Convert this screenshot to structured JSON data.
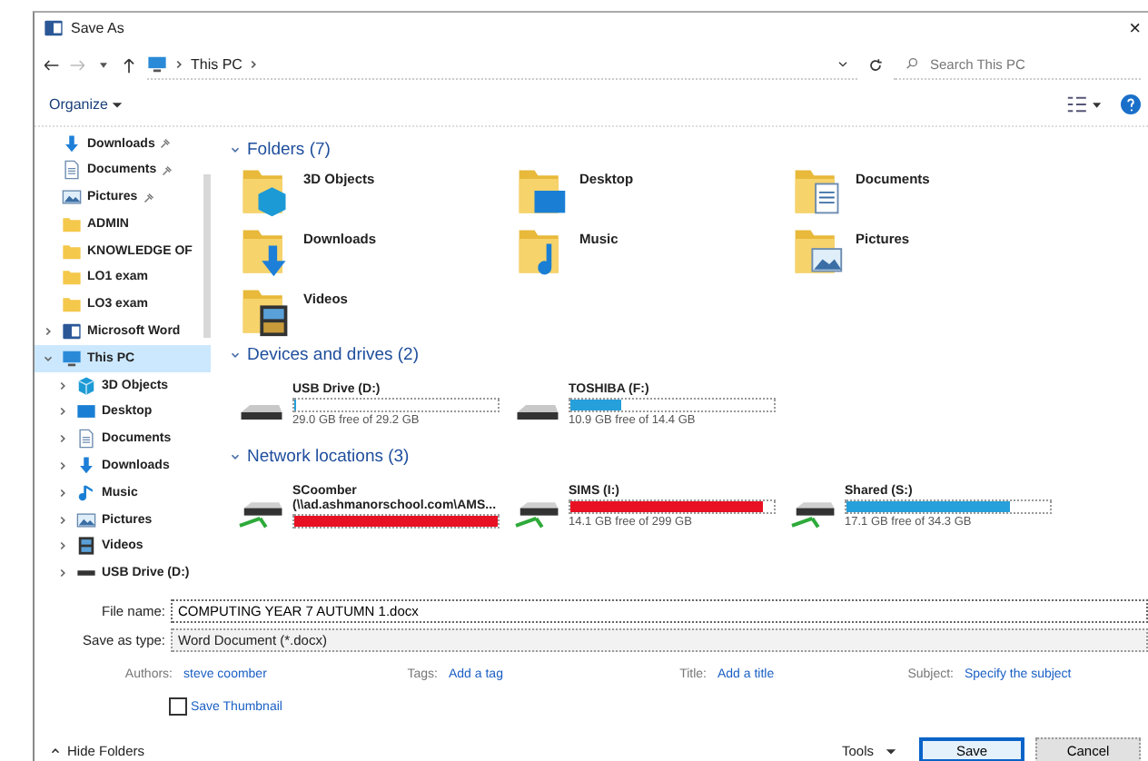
{
  "window": {
    "title": "Save As",
    "close": "×"
  },
  "address_bar": {
    "path": [
      "This PC"
    ]
  },
  "search": {
    "placeholder": "Search This PC"
  },
  "toolbar": {
    "organize": "Organize"
  },
  "sidebar": {
    "items": [
      {
        "label": "Downloads",
        "kind": "download",
        "pinned": true,
        "selected": false
      },
      {
        "label": "Documents",
        "kind": "document",
        "pinned": true,
        "selected": false
      },
      {
        "label": "Pictures",
        "kind": "picture",
        "pinned": true,
        "selected": false
      },
      {
        "label": "ADMIN",
        "kind": "folder",
        "pinned": false,
        "selected": false
      },
      {
        "label": "KNOWLEDGE OF",
        "kind": "folder",
        "pinned": false,
        "selected": false
      },
      {
        "label": "LO1 exam",
        "kind": "folder",
        "pinned": false,
        "selected": false
      },
      {
        "label": "LO3 exam",
        "kind": "folder",
        "pinned": false,
        "selected": false
      },
      {
        "label": "Microsoft Word",
        "kind": "word",
        "expanded": false,
        "selected": false
      },
      {
        "label": "This PC",
        "kind": "pc",
        "expanded": true,
        "selected": true,
        "children": [
          {
            "label": "3D Objects",
            "kind": "cube",
            "expanded": false,
            "selected": false
          },
          {
            "label": "Desktop",
            "kind": "desktop",
            "expanded": false,
            "selected": false
          },
          {
            "label": "Documents",
            "kind": "document",
            "expanded": false,
            "selected": false
          },
          {
            "label": "Downloads",
            "kind": "download",
            "expanded": false,
            "selected": false
          },
          {
            "label": "Music",
            "kind": "music",
            "expanded": false,
            "selected": false
          },
          {
            "label": "Pictures",
            "kind": "picture",
            "expanded": false,
            "selected": false
          },
          {
            "label": "Videos",
            "kind": "video",
            "expanded": false,
            "selected": false
          },
          {
            "label": "USB Drive (D:)",
            "kind": "drive",
            "expanded": false,
            "selected": false
          }
        ]
      }
    ]
  },
  "content": {
    "sections": [
      {
        "title": "Folders (7)",
        "kind": "folders",
        "expanded": true,
        "items": [
          {
            "name": "3D Objects",
            "kind": "cube"
          },
          {
            "name": "Desktop",
            "kind": "desktop"
          },
          {
            "name": "Documents",
            "kind": "document"
          },
          {
            "name": "Downloads",
            "kind": "download"
          },
          {
            "name": "Music",
            "kind": "music"
          },
          {
            "name": "Pictures",
            "kind": "picture"
          },
          {
            "name": "Videos",
            "kind": "video"
          }
        ]
      },
      {
        "title": "Devices and drives (2)",
        "kind": "drives",
        "expanded": true,
        "items": [
          {
            "name": "USB Drive (D:)",
            "kind": "usb",
            "level": 0.01,
            "color": "#26a0da",
            "free": "29.0 GB free of 29.2 GB"
          },
          {
            "name": "TOSHIBA (F:)",
            "kind": "usb",
            "level": 0.25,
            "color": "#26a0da",
            "free": "10.9 GB free of 14.4 GB"
          }
        ]
      },
      {
        "title": "Network locations (3)",
        "kind": "drives",
        "expanded": true,
        "items": [
          {
            "name": "SCoomber",
            "path": "(\\\\ad.ashmanorschool.com\\AMS...",
            "kind": "network",
            "level": 1,
            "color": "#e81123"
          },
          {
            "name": "SIMS (I:)",
            "kind": "network",
            "level": 0.95,
            "color": "#e81123",
            "free": "14.1 GB free of 299 GB"
          },
          {
            "name": "Shared (S:)",
            "kind": "network",
            "level": 0.8,
            "color": "#26a0da",
            "free": "17.1 GB free of 34.3 GB"
          }
        ]
      }
    ]
  },
  "form": {
    "file_name": {
      "label": "File name:",
      "value": "COMPUTING YEAR 7 AUTUMN 1.docx"
    },
    "save_as_type": {
      "label": "Save as type:",
      "value": "Word Document (*.docx)"
    },
    "properties": [
      {
        "label": "Authors:",
        "value": "steve coomber"
      },
      {
        "label": "Tags:",
        "value": "Add a tag"
      },
      {
        "label": "Title:",
        "value": "Add a title"
      },
      {
        "label": "Subject:",
        "value": "Specify the subject"
      }
    ],
    "save_thumbnail": {
      "label": "Save Thumbnail",
      "checked": false
    }
  },
  "footer": {
    "hide_folders": "Hide Folders",
    "tools": "Tools",
    "buttons": [
      "Save",
      "Cancel"
    ]
  }
}
